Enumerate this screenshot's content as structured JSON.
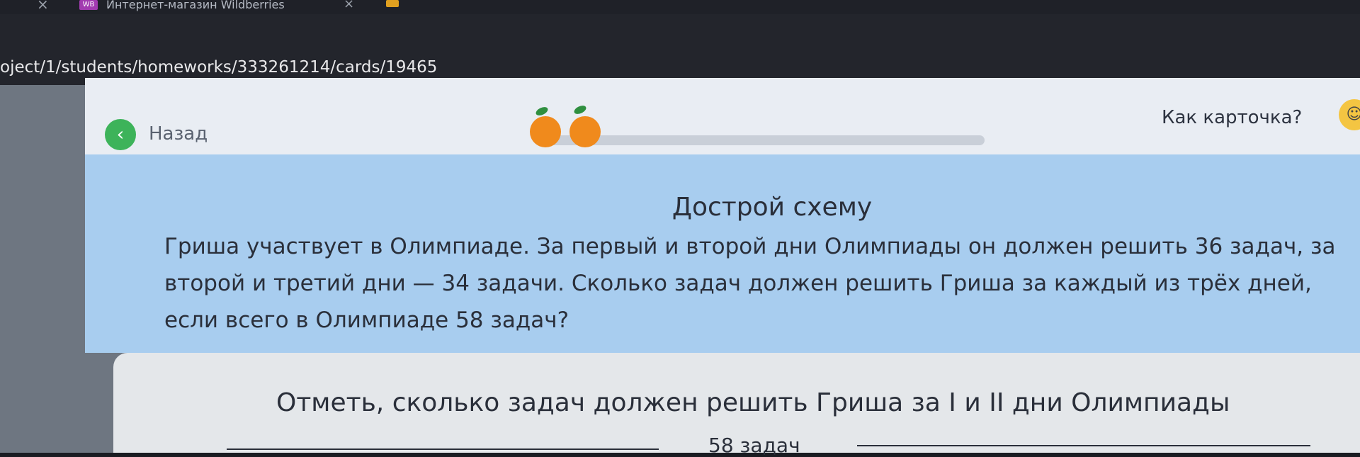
{
  "browser": {
    "tab_close": "×",
    "tab_favicon": "WB",
    "tab_title": "Интернет-магазин Wildberries",
    "url": "oject/1/students/homeworks/333261214/cards/19465"
  },
  "header": {
    "back_label": "Назад",
    "progress_fruits": 2,
    "feedback_label": "Как карточка?"
  },
  "task": {
    "title": "Дострой схему",
    "text": "Гриша участвует в Олимпиаде. За первый и второй дни Олимпиады он должен решить 36 задач, за второй и третий дни — 34 задачи. Сколько задач должен решить Гриша за каждый из трёх дней, если всего в Олимпиаде 58 задач?"
  },
  "answer": {
    "question": "Отметь, сколько задач должен решить Гриша за I и II дни Олимпиады",
    "scheme_total": "58 задач"
  },
  "colors": {
    "accent_green": "#3db35a",
    "task_bg": "#a8cdef",
    "orange": "#f08a1c"
  }
}
